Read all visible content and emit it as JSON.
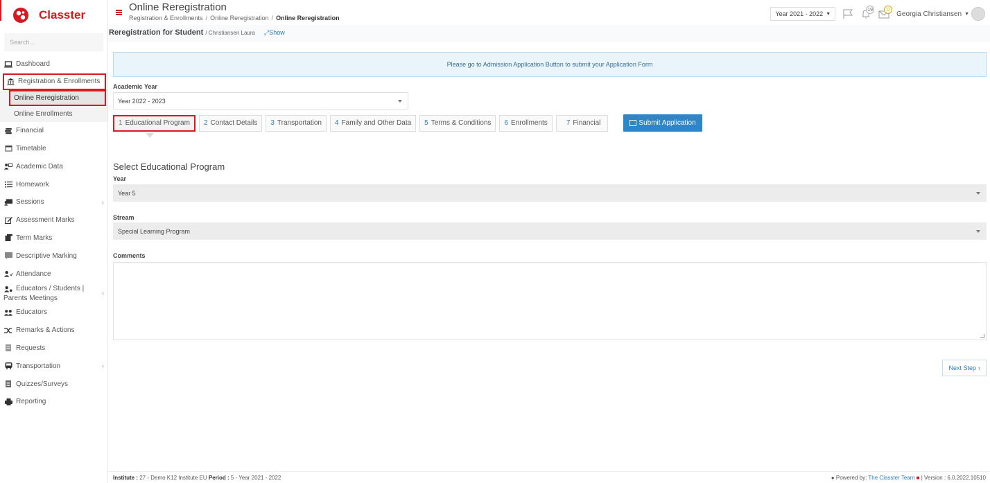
{
  "app": {
    "name": "Classter"
  },
  "sidebar": {
    "search_placeholder": "Search...",
    "items": [
      {
        "label": "Dashboard",
        "icon": "laptop-icon"
      },
      {
        "label": "Registration & Enrollments",
        "icon": "bank-icon"
      },
      {
        "label": "Online Reregistration"
      },
      {
        "label": "Online Enrollments"
      },
      {
        "label": "Financial",
        "icon": "money-icon"
      },
      {
        "label": "Timetable",
        "icon": "calendar-icon"
      },
      {
        "label": "Academic Data",
        "icon": "academic-icon"
      },
      {
        "label": "Homework",
        "icon": "list-icon"
      },
      {
        "label": "Sessions",
        "icon": "sessions-icon"
      },
      {
        "label": "Assessment Marks",
        "icon": "edit-icon"
      },
      {
        "label": "Term Marks",
        "icon": "term-icon"
      },
      {
        "label": "Descriptive Marking",
        "icon": "comment-icon"
      },
      {
        "label": "Attendance",
        "icon": "attendance-icon"
      },
      {
        "label": "Educators / Students | Parents Meetings",
        "icon": "meeting-icon"
      },
      {
        "label": "Educators",
        "icon": "users-icon"
      },
      {
        "label": "Remarks & Actions",
        "icon": "shuffle-icon"
      },
      {
        "label": "Requests",
        "icon": "document-icon"
      },
      {
        "label": "Transportation",
        "icon": "bus-icon"
      },
      {
        "label": "Quizzes/Surveys",
        "icon": "quiz-icon"
      },
      {
        "label": "Reporting",
        "icon": "print-icon"
      }
    ]
  },
  "header": {
    "title": "Online Reregistration",
    "breadcrumbs": [
      "Registration & Enrollments",
      "Online Reregistration",
      "Online Reregistration"
    ],
    "year_selector": "Year 2021 - 2022",
    "notifications_count": "19",
    "messages_count": "0",
    "user_name": "Georgia Christiansen"
  },
  "page": {
    "heading": "Reregistration for Student",
    "student": "/ Christiansen Laura",
    "show_link": "Show",
    "alert": "Please go to Admission Application Button to submit your Application Form",
    "academic_year_label": "Academic Year",
    "academic_year_value": "Year 2022 - 2023",
    "tabs": [
      {
        "num": "1",
        "label": "Educational Program"
      },
      {
        "num": "2",
        "label": "Contact Details"
      },
      {
        "num": "3",
        "label": "Transportation"
      },
      {
        "num": "4",
        "label": "Family and Other Data"
      },
      {
        "num": "5",
        "label": "Terms & Conditions"
      },
      {
        "num": "6",
        "label": "Enrollments"
      },
      {
        "num": "7",
        "label": "Financial"
      }
    ],
    "submit_label": "Submit Application",
    "section_title": "Select Educational Program",
    "year_label": "Year",
    "year_value": "Year 5",
    "stream_label": "Stream",
    "stream_value": "Special Learning Program",
    "comments_label": "Comments",
    "next_label": "Next Step"
  },
  "footer": {
    "institute_label": "Institute :",
    "institute_value": "27 - Demo K12 Institute EU",
    "period_label": "Period :",
    "period_value": "5 - Year 2021 - 2022",
    "powered_by": "Powered by:",
    "team": "The Classter Team",
    "version": "| Version : 6.0.2022.10510"
  },
  "colors": {
    "brand": "#d71920",
    "accent": "#2e86c9"
  }
}
